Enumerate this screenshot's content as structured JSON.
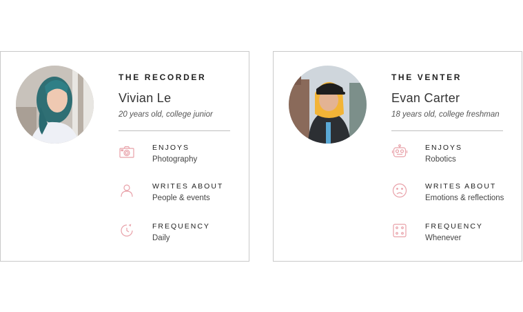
{
  "colors": {
    "icon_accent": "#e8a0a8",
    "border": "#c9c9c9"
  },
  "personas": [
    {
      "role": "THE RECORDER",
      "name": "Vivian Le",
      "description": "20 years old, college junior",
      "attributes": [
        {
          "label": "ENJOYS",
          "value": "Photography",
          "icon": "camera-icon"
        },
        {
          "label": "WRITES ABOUT",
          "value": "People & events",
          "icon": "person-icon"
        },
        {
          "label": "FREQUENCY",
          "value": "Daily",
          "icon": "clock-icon"
        }
      ]
    },
    {
      "role": "THE VENTER",
      "name": "Evan Carter",
      "description": "18 years old, college freshman",
      "attributes": [
        {
          "label": "ENJOYS",
          "value": "Robotics",
          "icon": "robot-icon"
        },
        {
          "label": "WRITES ABOUT",
          "value": "Emotions & reflections",
          "icon": "sad-face-icon"
        },
        {
          "label": "FREQUENCY",
          "value": "Whenever",
          "icon": "dice-icon"
        }
      ]
    }
  ]
}
